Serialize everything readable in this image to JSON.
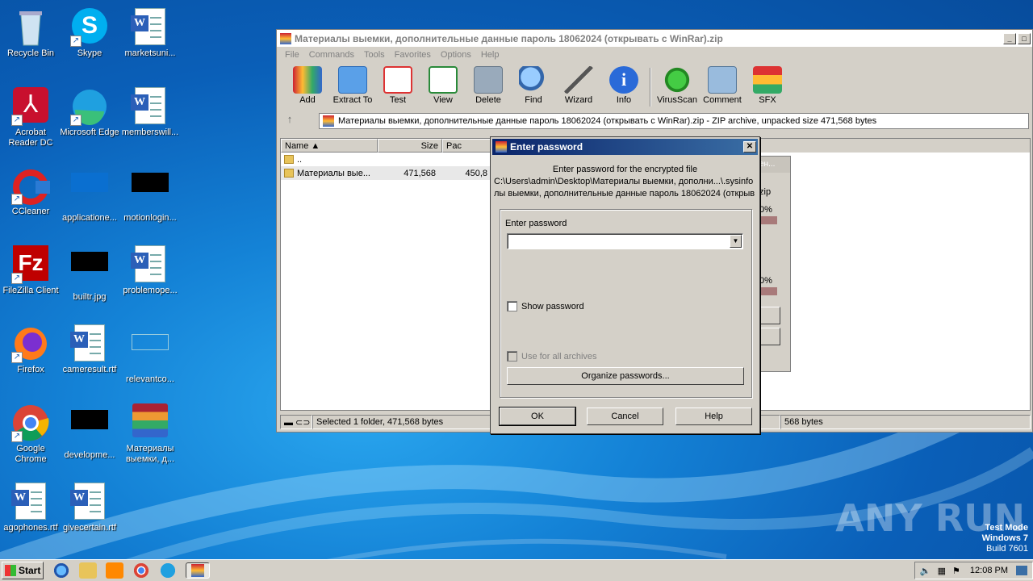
{
  "desktop": {
    "icons": [
      {
        "label": "Recycle Bin",
        "icon": "recycle-bin-icon"
      },
      {
        "label": "Skype",
        "icon": "skype-icon"
      },
      {
        "label": "marketsuni...",
        "icon": "word-doc-icon"
      },
      {
        "label": "Acrobat Reader DC",
        "icon": "acrobat-icon"
      },
      {
        "label": "Microsoft Edge",
        "icon": "edge-icon"
      },
      {
        "label": "memberswill...",
        "icon": "word-doc-icon"
      },
      {
        "label": "CCleaner",
        "icon": "ccleaner-icon"
      },
      {
        "label": "applicatione...",
        "icon": "file-icon"
      },
      {
        "label": "motionlogin...",
        "icon": "file-icon"
      },
      {
        "label": "FileZilla Client",
        "icon": "filezilla-icon"
      },
      {
        "label": "builtr.jpg",
        "icon": "image-file-icon"
      },
      {
        "label": "problemope...",
        "icon": "word-doc-icon"
      },
      {
        "label": "Firefox",
        "icon": "firefox-icon"
      },
      {
        "label": "cameresult.rtf",
        "icon": "word-doc-icon"
      },
      {
        "label": "relevantco...",
        "icon": "file-icon"
      },
      {
        "label": "Google Chrome",
        "icon": "chrome-icon"
      },
      {
        "label": "developme...",
        "icon": "file-icon"
      },
      {
        "label": "Материалы выемки, д...",
        "icon": "winrar-archive-icon"
      },
      {
        "label": "agophones.rtf",
        "icon": "word-doc-icon"
      },
      {
        "label": "givecertain.rtf",
        "icon": "word-doc-icon"
      }
    ]
  },
  "winrar": {
    "title": "Материалы выемки, дополнительные данные  пароль 18062024 (открывать с WinRar).zip",
    "menu": [
      "File",
      "Commands",
      "Tools",
      "Favorites",
      "Options",
      "Help"
    ],
    "toolbar": [
      "Add",
      "Extract To",
      "Test",
      "View",
      "Delete",
      "Find",
      "Wizard",
      "Info",
      "VirusScan",
      "Comment",
      "SFX"
    ],
    "address": "Материалы выемки, дополнительные данные  пароль 18062024 (открывать с WinRar).zip - ZIP archive, unpacked size 471,568 bytes",
    "columns": {
      "name": "Name",
      "size": "Size",
      "packed": "Pac"
    },
    "rows": [
      {
        "name": "..",
        "size": "",
        "packed": ""
      },
      {
        "name": "Материалы вые...",
        "size": "471,568",
        "packed": "450,8"
      }
    ],
    "status_left": "Selected 1 folder, 471,568 bytes",
    "status_right": "568 bytes"
  },
  "behind_panel": {
    "label_zip": "zip",
    "pct1": "0%",
    "pct2": "0%",
    "title": "ен..."
  },
  "dialog": {
    "title": "Enter password",
    "message_line1": "Enter password for the encrypted file",
    "message_line2": "C:\\Users\\admin\\Desktop\\Материалы выемки, дополни...\\.sysinfo",
    "message_line3": "лы выемки, дополнительные данные  пароль 18062024 (открыв",
    "password_label": "Enter password",
    "password_value": "",
    "show_password": "Show password",
    "use_all": "Use for all archives",
    "organize": "Organize passwords...",
    "ok": "OK",
    "cancel": "Cancel",
    "help": "Help"
  },
  "taskbar": {
    "start": "Start",
    "time": "12:08 PM"
  },
  "watermark": "ANY RUN",
  "testmode": {
    "line1": "Test Mode",
    "line2": "Windows 7",
    "line3": "Build 7601"
  }
}
